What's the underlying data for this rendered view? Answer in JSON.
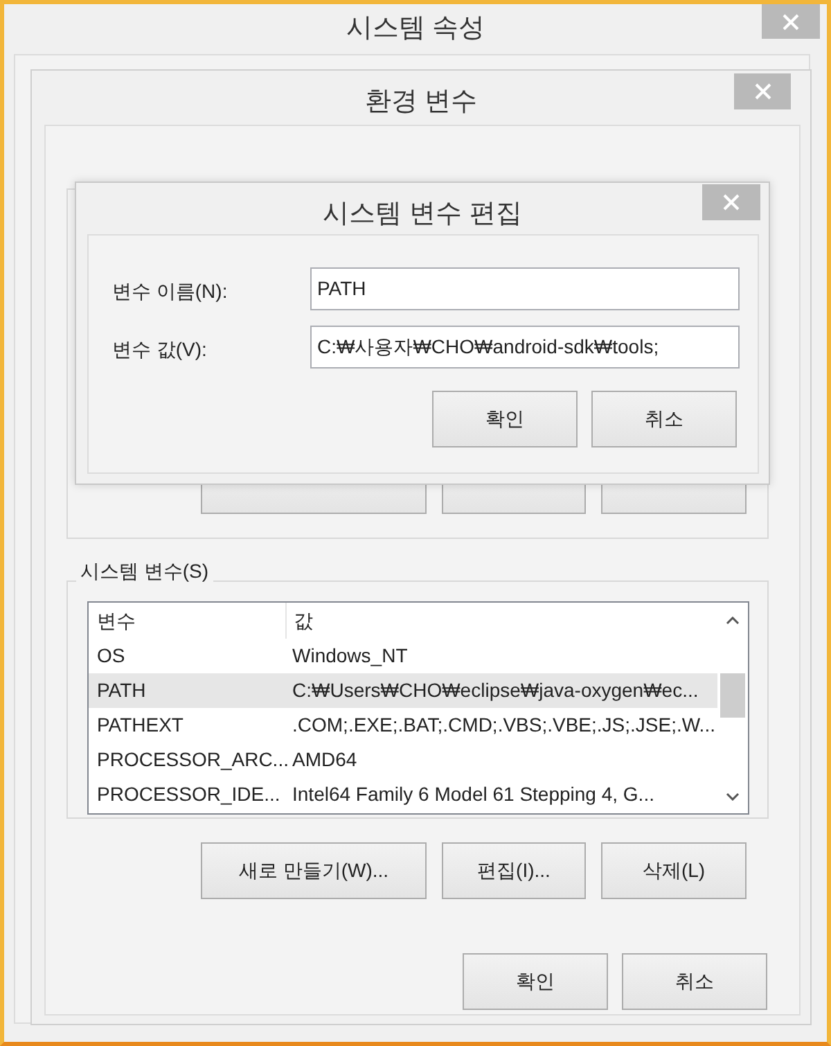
{
  "system_properties": {
    "title": "시스템 속성"
  },
  "environment_variables": {
    "title": "환경 변수",
    "system_variables": {
      "label": "시스템 변수(S)",
      "columns": [
        "변수",
        "값"
      ],
      "rows": [
        {
          "name": "OS",
          "value": "Windows_NT",
          "selected": false
        },
        {
          "name": "PATH",
          "value": "C:₩Users₩CHO₩eclipse₩java-oxygen₩ec...",
          "selected": true
        },
        {
          "name": "PATHEXT",
          "value": ".COM;.EXE;.BAT;.CMD;.VBS;.VBE;.JS;.JSE;.W...",
          "selected": false
        },
        {
          "name": "PROCESSOR_ARC...",
          "value": "AMD64",
          "selected": false
        },
        {
          "name": "PROCESSOR_IDE...",
          "value": "Intel64 Family 6 Model 61 Stepping 4, G...",
          "selected": false
        }
      ],
      "buttons": [
        "새로 만들기(W)...",
        "편집(I)...",
        "삭제(L)"
      ]
    },
    "buttons": [
      "확인",
      "취소"
    ]
  },
  "edit_dialog": {
    "title": "시스템 변수 편집",
    "fields": [
      {
        "label": "변수 이름(N):",
        "value": "PATH"
      },
      {
        "label": "변수 값(V):",
        "value": "C:₩사용자₩CHO₩android-sdk₩tools;"
      }
    ],
    "buttons": [
      "확인",
      "취소"
    ]
  }
}
